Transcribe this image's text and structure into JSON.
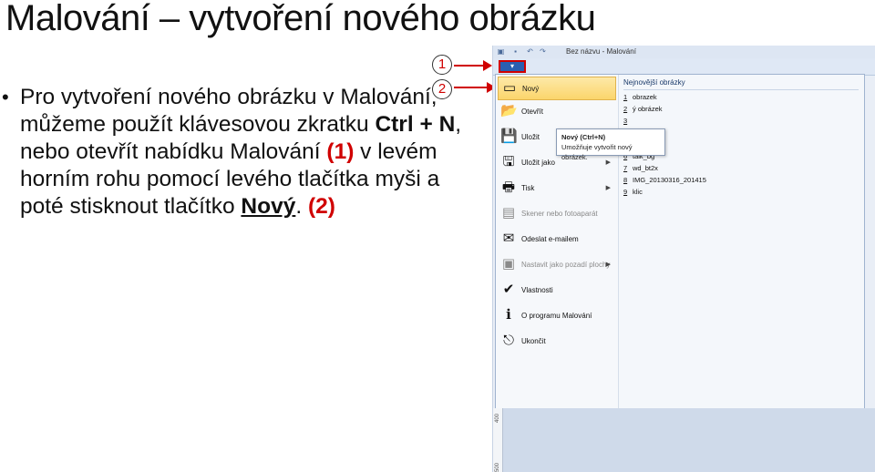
{
  "slide": {
    "title": "Malování – vytvoření nového obrázku",
    "bullet_symbol": "•",
    "text_part1": "Pro vytvoření nového obrázku v Malování, můžeme použít klávesovou zkratku ",
    "shortcut": "Ctrl + N",
    "text_part2": ", nebo otevřít nabídku Malování ",
    "callout1_ref": "(1)",
    "text_part3": " v levém horním rohu pomocí levého tlačítka myši a poté stisknout tlačítko ",
    "new_button_ref": "Nový",
    "text_part4": ". ",
    "callout2_ref": "(2)"
  },
  "callouts": {
    "one": "1",
    "two": "2"
  },
  "paint": {
    "window_title": "Bez názvu - Malování",
    "qat_icons": [
      "paint-app-icon",
      "save-icon",
      "undo-icon",
      "redo-icon"
    ],
    "file_button_icon": "▾",
    "menu": {
      "items": [
        {
          "label": "Nový",
          "icon": "new-file-icon",
          "glyph": "▭",
          "selected": true,
          "disabled": false,
          "has_submenu": false
        },
        {
          "label": "Otevřít",
          "icon": "open-folder-icon",
          "glyph": "📂",
          "selected": false,
          "disabled": false,
          "has_submenu": false
        },
        {
          "label": "Uložit",
          "icon": "floppy-icon",
          "glyph": "💾",
          "selected": false,
          "disabled": false,
          "has_submenu": false
        },
        {
          "label": "Uložit jako",
          "icon": "save-as-icon",
          "glyph": "🖫",
          "selected": false,
          "disabled": false,
          "has_submenu": true
        },
        {
          "label": "Tisk",
          "icon": "printer-icon",
          "glyph": "🖶",
          "selected": false,
          "disabled": false,
          "has_submenu": true
        },
        {
          "label": "Skener nebo fotoaparát",
          "icon": "scanner-icon",
          "glyph": "▤",
          "selected": false,
          "disabled": true,
          "has_submenu": false
        },
        {
          "label": "Odeslat e-mailem",
          "icon": "email-icon",
          "glyph": "✉",
          "selected": false,
          "disabled": false,
          "has_submenu": false
        },
        {
          "label": "Nastavit jako pozadí plochy",
          "icon": "desktop-background-icon",
          "glyph": "▣",
          "selected": false,
          "disabled": true,
          "has_submenu": true
        },
        {
          "label": "Vlastnosti",
          "icon": "checkmark-icon",
          "glyph": "✔",
          "selected": false,
          "disabled": false,
          "has_submenu": false
        },
        {
          "label": "O programu Malování",
          "icon": "info-icon",
          "glyph": "ℹ",
          "selected": false,
          "disabled": false,
          "has_submenu": false
        },
        {
          "label": "Ukončit",
          "icon": "exit-icon",
          "glyph": "⎋",
          "selected": false,
          "disabled": false,
          "has_submenu": false
        }
      ],
      "recent_title": "Nejnovější obrázky",
      "recent": [
        {
          "num": "1",
          "name": "obrazek"
        },
        {
          "num": "2",
          "name": "ý obrázek"
        },
        {
          "num": "3",
          "name": ""
        },
        {
          "num": "4",
          "name": "asf"
        },
        {
          "num": "5",
          "name": "fmx"
        },
        {
          "num": "6",
          "name": "talk_bg"
        },
        {
          "num": "7",
          "name": "wd_bt2x"
        },
        {
          "num": "8",
          "name": "IMG_20130316_201415"
        },
        {
          "num": "9",
          "name": "klic"
        }
      ]
    },
    "tooltip": {
      "title": "Nový (Ctrl+N)",
      "text": "Umožňuje vytvořit nový obrázek."
    },
    "ruler_labels": [
      "400",
      "500"
    ]
  }
}
